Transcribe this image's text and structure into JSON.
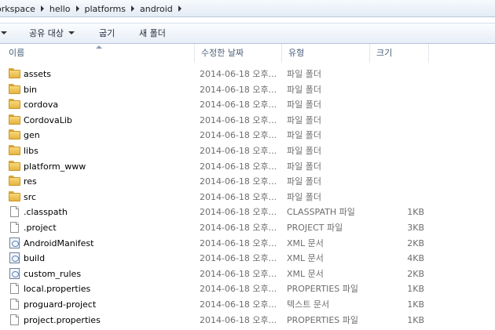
{
  "breadcrumb": [
    "orkspace",
    "hello",
    "platforms",
    "android"
  ],
  "toolbar": {
    "share_label": "공유 대상",
    "burn_label": "굽기",
    "new_folder_label": "새 폴더"
  },
  "columns": {
    "name": "이름",
    "date": "수정한 날짜",
    "type": "유형",
    "size": "크기"
  },
  "files": [
    {
      "name": "assets",
      "date": "2014-06-18 오후...",
      "type": "파일 폴더",
      "size": "",
      "icon": "folder-icon"
    },
    {
      "name": "bin",
      "date": "2014-06-18 오후...",
      "type": "파일 폴더",
      "size": "",
      "icon": "folder-icon"
    },
    {
      "name": "cordova",
      "date": "2014-06-18 오후...",
      "type": "파일 폴더",
      "size": "",
      "icon": "folder-icon"
    },
    {
      "name": "CordovaLib",
      "date": "2014-06-18 오후...",
      "type": "파일 폴더",
      "size": "",
      "icon": "folder-icon"
    },
    {
      "name": "gen",
      "date": "2014-06-18 오후...",
      "type": "파일 폴더",
      "size": "",
      "icon": "folder-icon"
    },
    {
      "name": "libs",
      "date": "2014-06-18 오후...",
      "type": "파일 폴더",
      "size": "",
      "icon": "folder-icon"
    },
    {
      "name": "platform_www",
      "date": "2014-06-18 오후...",
      "type": "파일 폴더",
      "size": "",
      "icon": "folder-icon"
    },
    {
      "name": "res",
      "date": "2014-06-18 오후...",
      "type": "파일 폴더",
      "size": "",
      "icon": "folder-icon"
    },
    {
      "name": "src",
      "date": "2014-06-18 오후...",
      "type": "파일 폴더",
      "size": "",
      "icon": "folder-icon"
    },
    {
      "name": ".classpath",
      "date": "2014-06-18 오후...",
      "type": "CLASSPATH 파일",
      "size": "1KB",
      "icon": "file-icon"
    },
    {
      "name": ".project",
      "date": "2014-06-18 오후...",
      "type": "PROJECT 파일",
      "size": "3KB",
      "icon": "file-icon"
    },
    {
      "name": "AndroidManifest",
      "date": "2014-06-18 오후...",
      "type": "XML 문서",
      "size": "2KB",
      "icon": "xml-file-icon"
    },
    {
      "name": "build",
      "date": "2014-06-18 오후...",
      "type": "XML 문서",
      "size": "4KB",
      "icon": "xml-file-icon"
    },
    {
      "name": "custom_rules",
      "date": "2014-06-18 오후...",
      "type": "XML 문서",
      "size": "2KB",
      "icon": "xml-file-icon"
    },
    {
      "name": "local.properties",
      "date": "2014-06-18 오후...",
      "type": "PROPERTIES 파일",
      "size": "1KB",
      "icon": "file-icon"
    },
    {
      "name": "proguard-project",
      "date": "2014-06-18 오후...",
      "type": "텍스트 문서",
      "size": "1KB",
      "icon": "file-icon"
    },
    {
      "name": "project.properties",
      "date": "2014-06-18 오후...",
      "type": "PROPERTIES 파일",
      "size": "1KB",
      "icon": "file-icon"
    }
  ]
}
